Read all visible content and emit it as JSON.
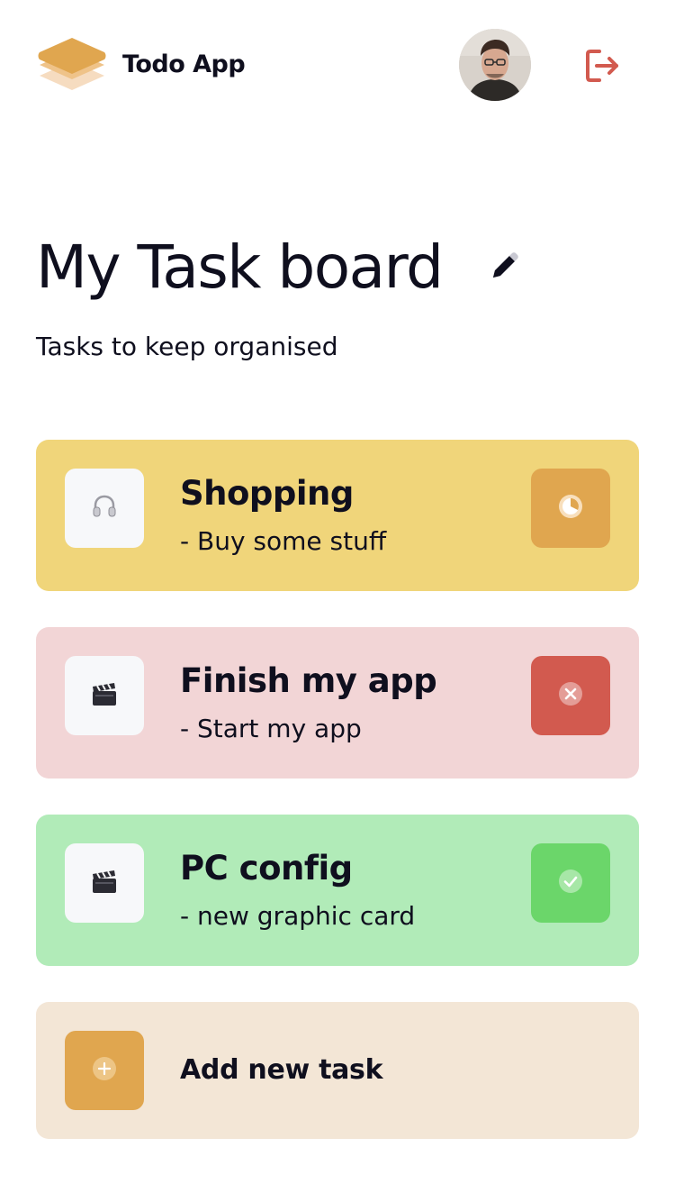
{
  "header": {
    "app_name": "Todo App",
    "logo_icon": "stacked-layers-icon",
    "avatar_icon": "user-avatar",
    "logout_icon": "logout-icon"
  },
  "board": {
    "title": "My Task board",
    "subtitle": "Tasks to keep organised",
    "edit_icon": "pencil-icon"
  },
  "tasks": [
    {
      "title": "Shopping",
      "description": "- Buy some stuff",
      "icon": "headphones-icon",
      "status": "in-progress",
      "status_icon": "clock-icon",
      "card_color": "#f0d57a",
      "status_color": "#e0a64f"
    },
    {
      "title": "Finish my app",
      "description": "- Start my app",
      "icon": "clapperboard-icon",
      "status": "wont-do",
      "status_icon": "close-icon",
      "card_color": "#f2d5d6",
      "status_color": "#d25a4f"
    },
    {
      "title": "PC config",
      "description": "- new graphic card",
      "icon": "clapperboard-icon",
      "status": "completed",
      "status_icon": "check-icon",
      "card_color": "#b1ebb8",
      "status_color": "#6bd66a"
    }
  ],
  "add_task": {
    "label": "Add new task",
    "icon": "plus-icon",
    "card_color": "#f3e6d6",
    "icon_color": "#e0a64f"
  }
}
